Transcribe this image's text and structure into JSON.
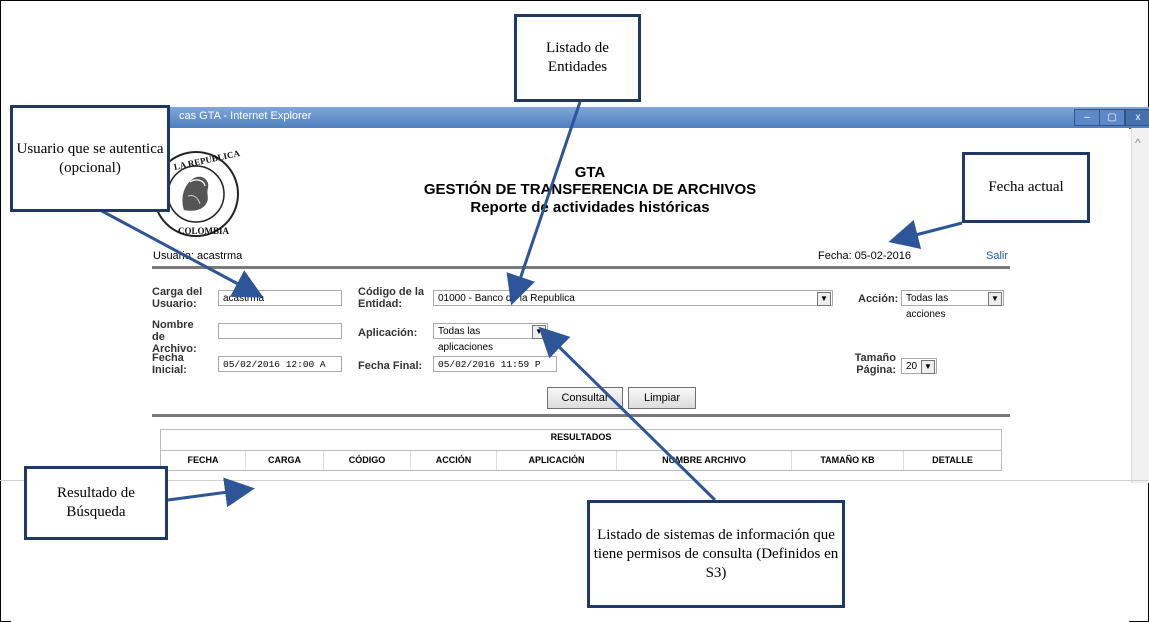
{
  "window": {
    "title": "cas GTA - Internet Explorer",
    "min": "–",
    "max": "▢",
    "close": "x"
  },
  "header": {
    "title": "GTA",
    "subtitle": "GESTIÓN DE TRANSFERENCIA DE ARCHIVOS",
    "report": "Reporte de actividades históricas"
  },
  "logo": {
    "text_top": "LA REPUBLICA",
    "text_bottom": "COLOMBIA"
  },
  "user_line": {
    "usuario": "Usuario: acastrma",
    "fecha": "Fecha: 05-02-2016",
    "salir": "Salir"
  },
  "form": {
    "carga_label": "Carga del Usuario:",
    "carga_value": "acastrma",
    "codigo_label": "Código de la Entidad:",
    "codigo_value": "01000 - Banco de la Republica",
    "accion_label": "Acción:",
    "accion_value": "Todas las acciones",
    "nombre_label": "Nombre de Archivo:",
    "nombre_value": "",
    "aplicacion_label": "Aplicación:",
    "aplicacion_value": "Todas las aplicaciones",
    "fecha_inicial_label": "Fecha Inicial:",
    "fecha_inicial_value": "05/02/2016 12:00 A",
    "fecha_final_label": "Fecha Final:",
    "fecha_final_value": "05/02/2016 11:59 P",
    "tamano_label": "Tamaño Página:",
    "tamano_value": "20",
    "consultar": "Consultar",
    "limpiar": "Limpiar"
  },
  "results": {
    "title": "RESULTADOS",
    "columns": [
      "FECHA",
      "CARGA",
      "CÓDIGO",
      "ACCIÓN",
      "APLICACIÓN",
      "NOMBRE ARCHIVO",
      "TAMAÑO KB",
      "DETALLE"
    ]
  },
  "callouts": {
    "usuario": "Usuario que se autentica (opcional)",
    "entidades": "Listado de Entidades",
    "fecha_actual": "Fecha actual",
    "resultado": "Resultado de Búsqueda",
    "sistemas": "Listado de sistemas de información que tiene permisos de consulta (Definidos en S3)"
  },
  "colors": {
    "callout_border": "#1f3864",
    "arrow": "#2e5597",
    "link": "#1a5fb4"
  }
}
